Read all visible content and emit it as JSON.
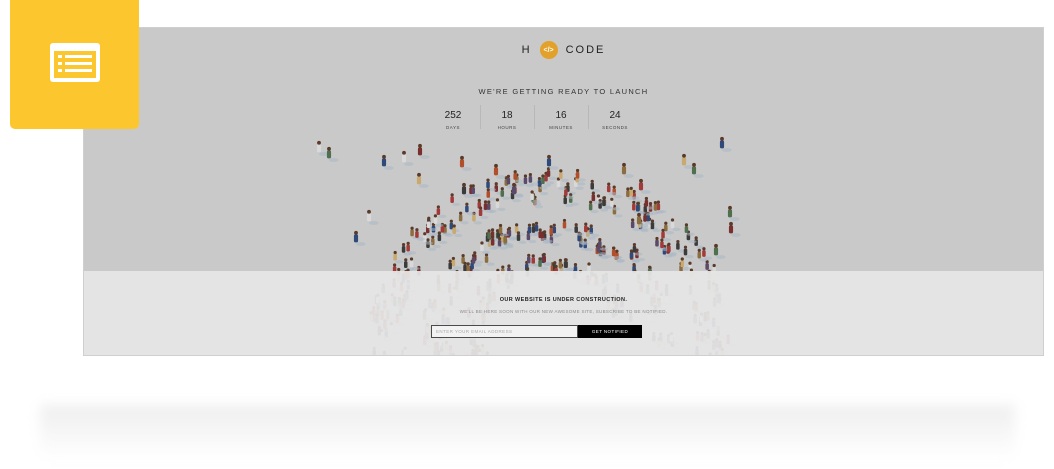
{
  "brand": {
    "left_letter": "H",
    "mark_glyph": "</>",
    "right_text": "CODE",
    "accent_color": "#e2a12b"
  },
  "headline": "WE'RE GETTING READY TO LAUNCH",
  "countdown": [
    {
      "value": "252",
      "label": "DAYS"
    },
    {
      "value": "18",
      "label": "HOURS"
    },
    {
      "value": "16",
      "label": "MINUTES"
    },
    {
      "value": "24",
      "label": "SECONDS"
    }
  ],
  "construction": {
    "title": "OUR WEBSITE IS UNDER CONSTRUCTION.",
    "subtitle": "WE'LL BE HERE SOON WITH OUR NEW AWESOME SITE, SUBSCRIBE TO BE NOTIFIED.",
    "email_placeholder": "ENTER YOUR EMAIL ADDRESS",
    "button_label": "GET NOTIFIED"
  },
  "badge": {
    "icon": "list-window-icon",
    "color": "#fcc72e"
  }
}
